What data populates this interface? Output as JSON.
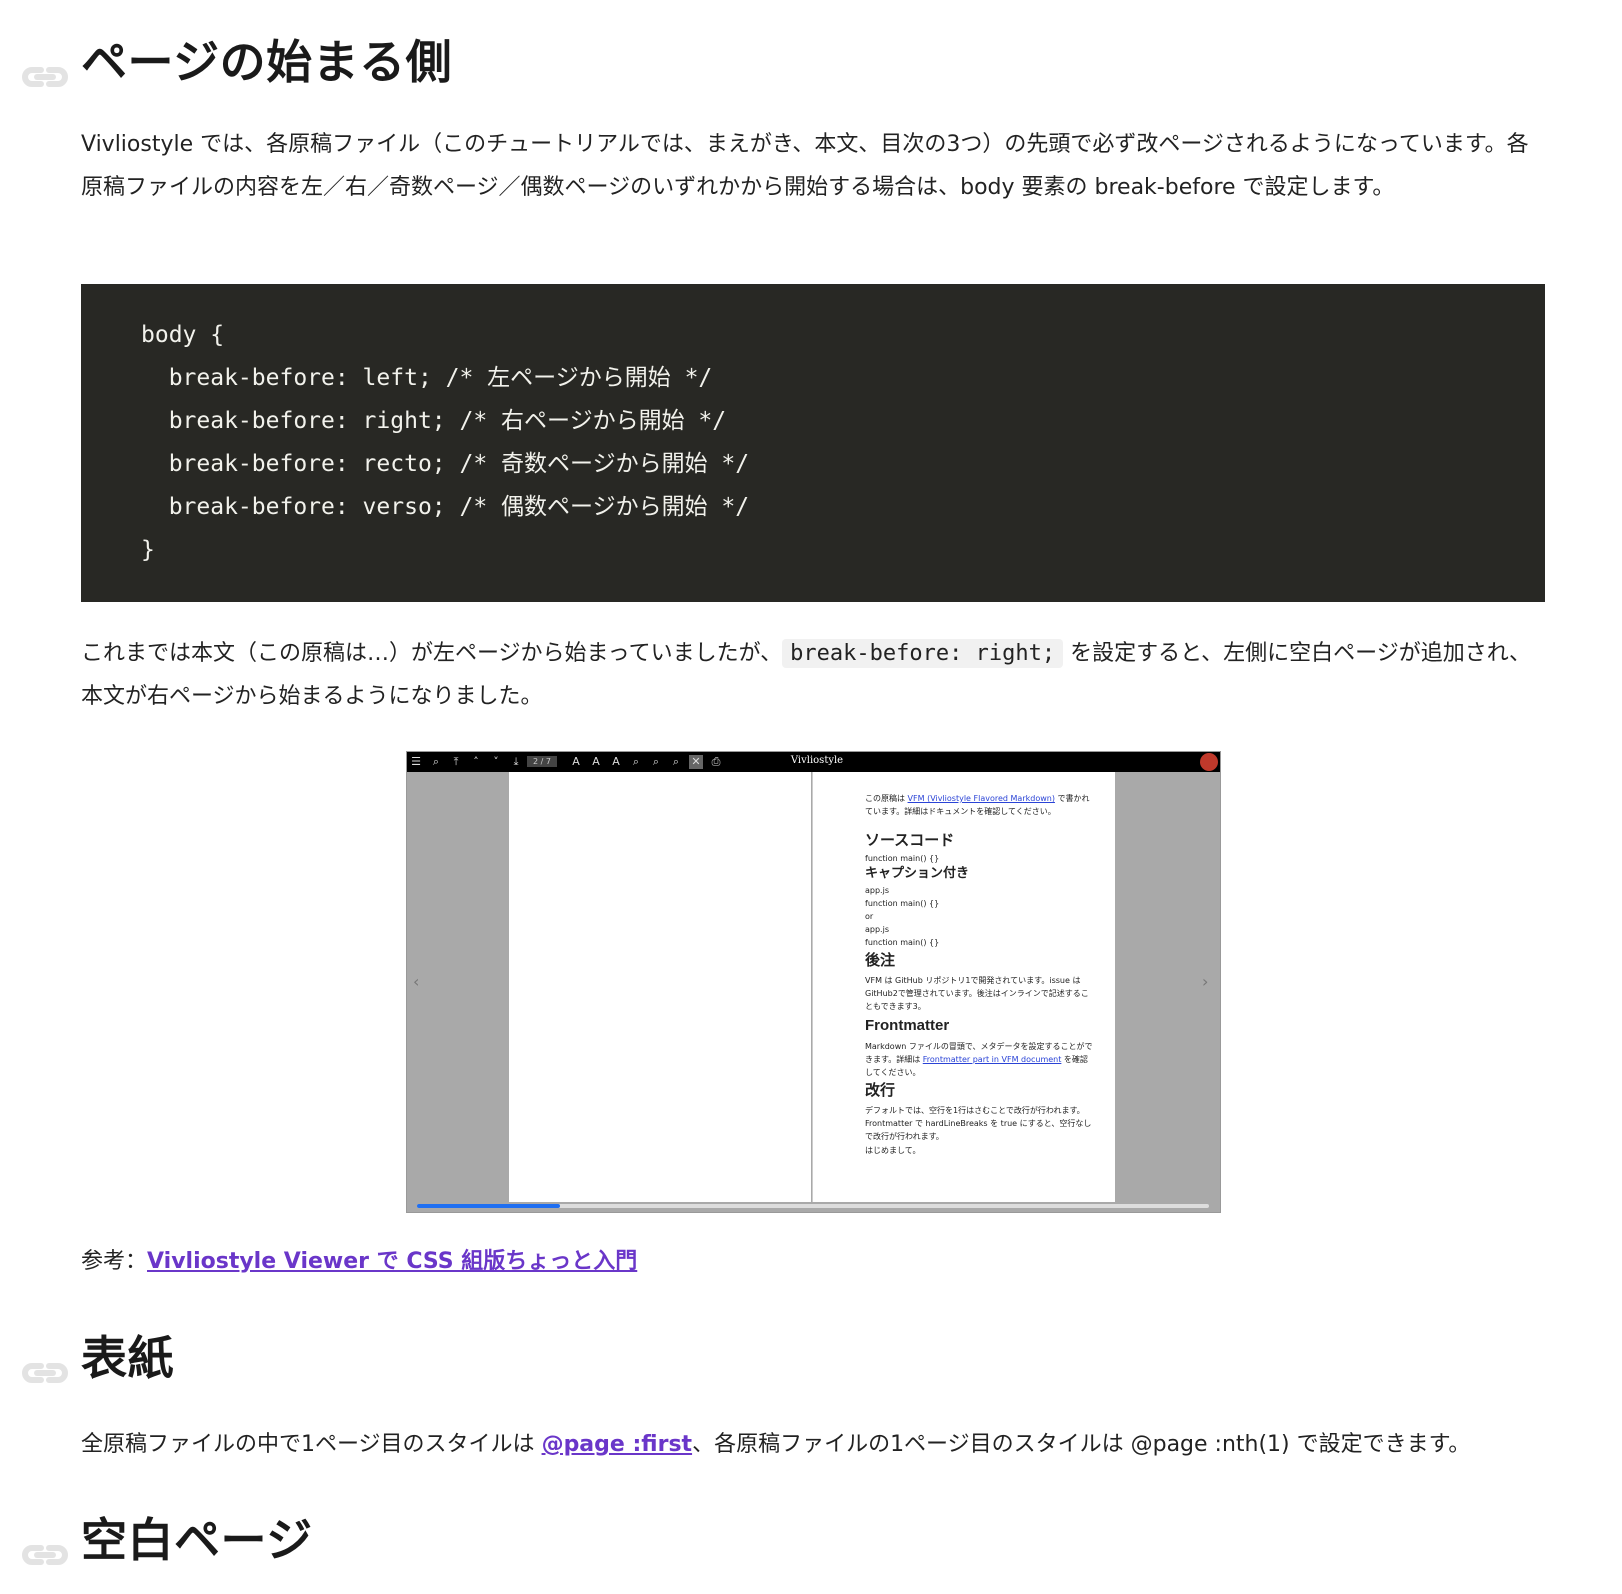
{
  "section1": {
    "heading": "ページの始まる側",
    "intro": "Vivliostyle では、各原稿ファイル（このチュートリアルでは、まえがき、本文、目次の3つ）の先頭で必ず改ページされるようになっています。各原稿ファイルの内容を左／右／奇数ページ／偶数ページのいずれかから開始する場合は、body 要素の break-before で設定します。",
    "code_lines": [
      "body {",
      "  break-before: left; /* 左ページから開始 */",
      "  break-before: right; /* 右ページから開始 */",
      "  break-before: recto; /* 奇数ページから開始 */",
      "  break-before: verso; /* 偶数ページから開始 */",
      "}"
    ],
    "after_code_before": "これまでは本文（この原稿は…）が左ページから始まっていましたが、",
    "after_code_inline": "break-before: right;",
    "after_code_after": "を設定すると、左側に空白ページが追加され、本文が右ページから始まるようになりました。",
    "reference_label": "参考：",
    "reference_link": "Vivliostyle Viewer で CSS 組版ちょっと入門"
  },
  "viewer": {
    "title": "Vivliostyle",
    "page_indicator": "2 / 7",
    "progress": 0.18,
    "right_page": {
      "intro_before": "この原稿は ",
      "intro_link": "VFM (Vivliostyle Flavored Markdown)",
      "intro_after": " で書かれています。詳細はドキュメントを確認してください。",
      "h_source": "ソースコード",
      "code1": "function main() {}",
      "h_caption": "キャプション付き",
      "caption_lines": [
        "app.js",
        "function main() {}",
        "or",
        "app.js",
        "function main() {}"
      ],
      "h_footnote": "後注",
      "footnote_text": "VFM は GitHub リポジトリ1で開発されています。issue は GitHub2で管理されています。後注はインラインで記述することもできます3。",
      "h_frontmatter": "Frontmatter",
      "frontmatter_before": "Markdown ファイルの冒頭で、メタデータを設定することができます。詳細は ",
      "frontmatter_link": "Frontmatter part in VFM document",
      "frontmatter_after": " を確認してください。",
      "h_break": "改行",
      "break_text": "デフォルトでは、空行を1行はさむことで改行が行われます。Frontmatter で hardLineBreaks を true にすると、空行なしで改行が行われます。",
      "break_last": "はじめまして。"
    }
  },
  "section2": {
    "heading": "表紙",
    "text_before": "全原稿ファイルの中で1ページ目のスタイルは ",
    "link": "@page :first",
    "text_after": "、各原稿ファイルの1ページ目のスタイルは @page :nth(1) で設定できます。"
  },
  "section3": {
    "heading": "空白ページ"
  },
  "colors": {
    "code_bg": "#282824",
    "link": "#6a36c9",
    "anchor_icon": "#e3e3e3"
  }
}
